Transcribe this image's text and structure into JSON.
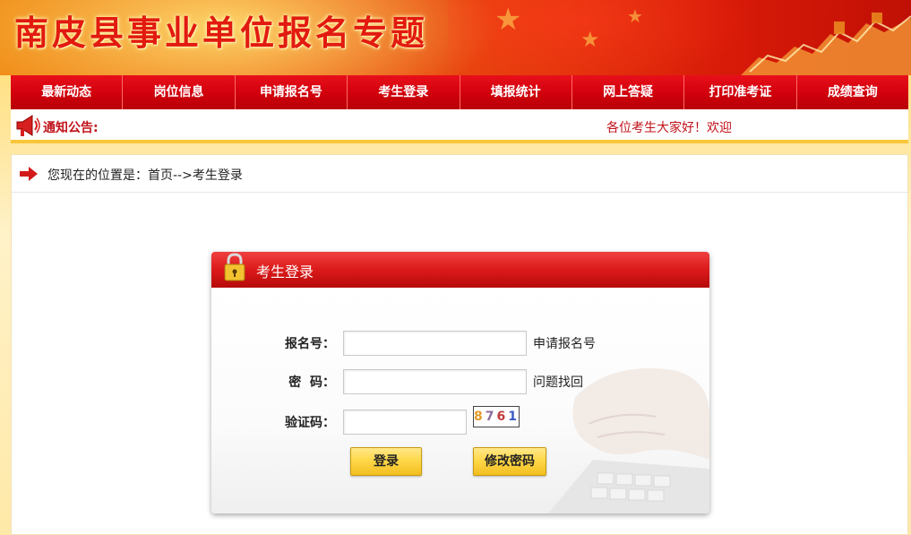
{
  "banner": {
    "title": "南皮县事业单位报名专题"
  },
  "nav": {
    "items": [
      {
        "label": "最新动态"
      },
      {
        "label": "岗位信息"
      },
      {
        "label": "申请报名号"
      },
      {
        "label": "考生登录"
      },
      {
        "label": "填报统计"
      },
      {
        "label": "网上答疑"
      },
      {
        "label": "打印准考证"
      },
      {
        "label": "成绩查询"
      }
    ]
  },
  "notice": {
    "label": "通知公告:",
    "text": "各位考生大家好！欢迎"
  },
  "breadcrumb": {
    "text": "您现在的位置是：首页-->考生登录"
  },
  "login": {
    "title": "考生登录",
    "reg_no_label": "报名号：",
    "reg_no_value": "",
    "apply_link": "申请报名号",
    "password_label": "密  码：",
    "password_value": "",
    "recover_link": "问题找回",
    "captcha_label": "验证码：",
    "captcha_value": "",
    "captcha_digits": [
      "8",
      "7",
      "6",
      "1"
    ],
    "login_button": "登录",
    "change_pwd_button": "修改密码"
  },
  "colors": {
    "nav_red": "#d0000c",
    "title_red": "#e21a10",
    "notice_red": "#c1121a",
    "button_gold": "#ffd84a"
  }
}
